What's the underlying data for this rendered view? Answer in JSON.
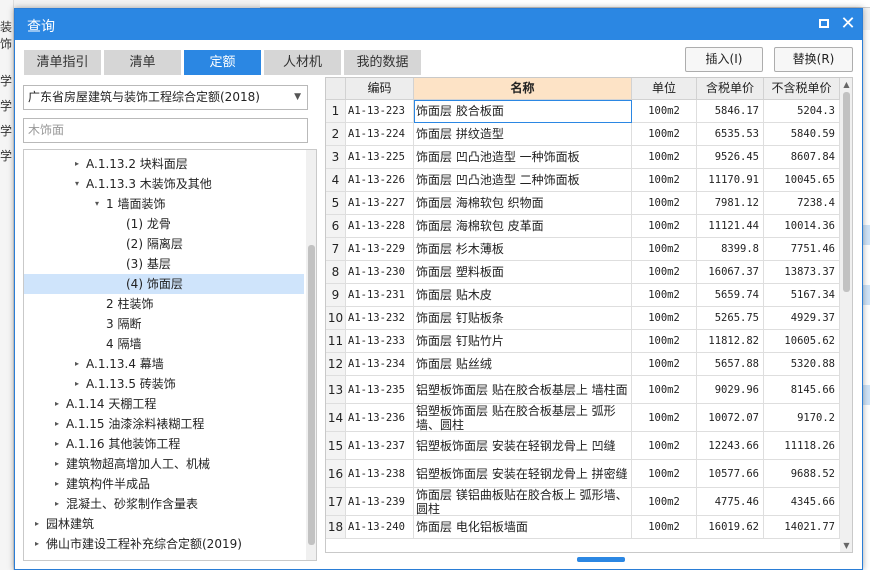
{
  "background": {
    "left_labels": [
      "装饰",
      "学",
      "学",
      "学",
      "学"
    ]
  },
  "dialog": {
    "title": "查询",
    "close_glyph": "✕"
  },
  "tabs": [
    {
      "label": "清单指引",
      "active": false
    },
    {
      "label": "清单",
      "active": false
    },
    {
      "label": "定额",
      "active": true
    },
    {
      "label": "人材机",
      "active": false
    },
    {
      "label": "我的数据",
      "active": false
    }
  ],
  "actions": {
    "insert": "插入(I)",
    "replace": "替换(R)"
  },
  "left": {
    "library": "广东省房屋建筑与装饰工程综合定额(2018)",
    "search_placeholder": "木饰面",
    "tree": [
      {
        "label": "A.1.13.2 块料面层",
        "toggle": "▸",
        "level": 3
      },
      {
        "label": "A.1.13.3 木装饰及其他",
        "toggle": "▾",
        "level": 3
      },
      {
        "label": "1 墙面装饰",
        "toggle": "▾",
        "level": 4
      },
      {
        "label": "(1) 龙骨",
        "toggle": "",
        "level": 5
      },
      {
        "label": "(2) 隔离层",
        "toggle": "",
        "level": 5
      },
      {
        "label": "(3) 基层",
        "toggle": "",
        "level": 5
      },
      {
        "label": "(4) 饰面层",
        "toggle": "",
        "level": 5,
        "selected": true
      },
      {
        "label": "2 柱装饰",
        "toggle": "",
        "level": 4
      },
      {
        "label": "3 隔断",
        "toggle": "",
        "level": 4
      },
      {
        "label": "4 隔墙",
        "toggle": "",
        "level": 4
      },
      {
        "label": "A.1.13.4 幕墙",
        "toggle": "▸",
        "level": 3
      },
      {
        "label": "A.1.13.5 砖装饰",
        "toggle": "▸",
        "level": 3
      },
      {
        "label": "A.1.14 天棚工程",
        "toggle": "▸",
        "level": 2
      },
      {
        "label": "A.1.15 油漆涂料裱糊工程",
        "toggle": "▸",
        "level": 2
      },
      {
        "label": "A.1.16 其他装饰工程",
        "toggle": "▸",
        "level": 2
      },
      {
        "label": "建筑物超高增加人工、机械",
        "toggle": "▸",
        "level": 2
      },
      {
        "label": "建筑构件半成品",
        "toggle": "▸",
        "level": 2
      },
      {
        "label": "混凝土、砂浆制作含量表",
        "toggle": "▸",
        "level": 2
      },
      {
        "label": "园林建筑",
        "toggle": "▸",
        "level": 1
      },
      {
        "label": "佛山市建设工程补充综合定额(2019)",
        "toggle": "▸",
        "level": 1
      }
    ]
  },
  "table": {
    "headers": {
      "code": "编码",
      "name": "名称",
      "unit": "单位",
      "tax": "含税单价",
      "notax": "不含税单价"
    },
    "rows": [
      {
        "idx": "1",
        "code": "A1-13-223",
        "name": "饰面层 胶合板面",
        "unit": "100m2",
        "tax": "5846.17",
        "notax": "5204.3"
      },
      {
        "idx": "2",
        "code": "A1-13-224",
        "name": "饰面层 拼纹造型",
        "unit": "100m2",
        "tax": "6535.53",
        "notax": "5840.59"
      },
      {
        "idx": "3",
        "code": "A1-13-225",
        "name": "饰面层 凹凸池造型 一种饰面板",
        "unit": "100m2",
        "tax": "9526.45",
        "notax": "8607.84"
      },
      {
        "idx": "4",
        "code": "A1-13-226",
        "name": "饰面层 凹凸池造型 二种饰面板",
        "unit": "100m2",
        "tax": "11170.91",
        "notax": "10045.65"
      },
      {
        "idx": "5",
        "code": "A1-13-227",
        "name": "饰面层 海棉软包 织物面",
        "unit": "100m2",
        "tax": "7981.12",
        "notax": "7238.4"
      },
      {
        "idx": "6",
        "code": "A1-13-228",
        "name": "饰面层 海棉软包 皮革面",
        "unit": "100m2",
        "tax": "11121.44",
        "notax": "10014.36"
      },
      {
        "idx": "7",
        "code": "A1-13-229",
        "name": "饰面层 杉木薄板",
        "unit": "100m2",
        "tax": "8399.8",
        "notax": "7751.46"
      },
      {
        "idx": "8",
        "code": "A1-13-230",
        "name": "饰面层 塑料板面",
        "unit": "100m2",
        "tax": "16067.37",
        "notax": "13873.37"
      },
      {
        "idx": "9",
        "code": "A1-13-231",
        "name": "饰面层 贴木皮",
        "unit": "100m2",
        "tax": "5659.74",
        "notax": "5167.34"
      },
      {
        "idx": "10",
        "code": "A1-13-232",
        "name": "饰面层 钉贴板条",
        "unit": "100m2",
        "tax": "5265.75",
        "notax": "4929.37"
      },
      {
        "idx": "11",
        "code": "A1-13-233",
        "name": "饰面层 钉贴竹片",
        "unit": "100m2",
        "tax": "11812.82",
        "notax": "10605.62"
      },
      {
        "idx": "12",
        "code": "A1-13-234",
        "name": "饰面层 贴丝绒",
        "unit": "100m2",
        "tax": "5657.88",
        "notax": "5320.88"
      },
      {
        "idx": "13",
        "code": "A1-13-235",
        "name": "铝塑板饰面层 贴在胶合板基层上 墙柱面",
        "unit": "100m2",
        "tax": "9029.96",
        "notax": "8145.66"
      },
      {
        "idx": "14",
        "code": "A1-13-236",
        "name": "铝塑板饰面层 贴在胶合板基层上 弧形墙、圆柱",
        "unit": "100m2",
        "tax": "10072.07",
        "notax": "9170.2"
      },
      {
        "idx": "15",
        "code": "A1-13-237",
        "name": "铝塑板饰面层 安装在轻钢龙骨上 凹缝",
        "unit": "100m2",
        "tax": "12243.66",
        "notax": "11118.26"
      },
      {
        "idx": "16",
        "code": "A1-13-238",
        "name": "铝塑板饰面层 安装在轻钢龙骨上 拼密缝",
        "unit": "100m2",
        "tax": "10577.66",
        "notax": "9688.52"
      },
      {
        "idx": "17",
        "code": "A1-13-239",
        "name": "饰面层 镁铝曲板贴在胶合板上 弧形墙、圆柱",
        "unit": "100m2",
        "tax": "4775.46",
        "notax": "4345.66"
      },
      {
        "idx": "18",
        "code": "A1-13-240",
        "name": "饰面层 电化铝板墙面",
        "unit": "100m2",
        "tax": "16019.62",
        "notax": "14021.77"
      }
    ]
  }
}
